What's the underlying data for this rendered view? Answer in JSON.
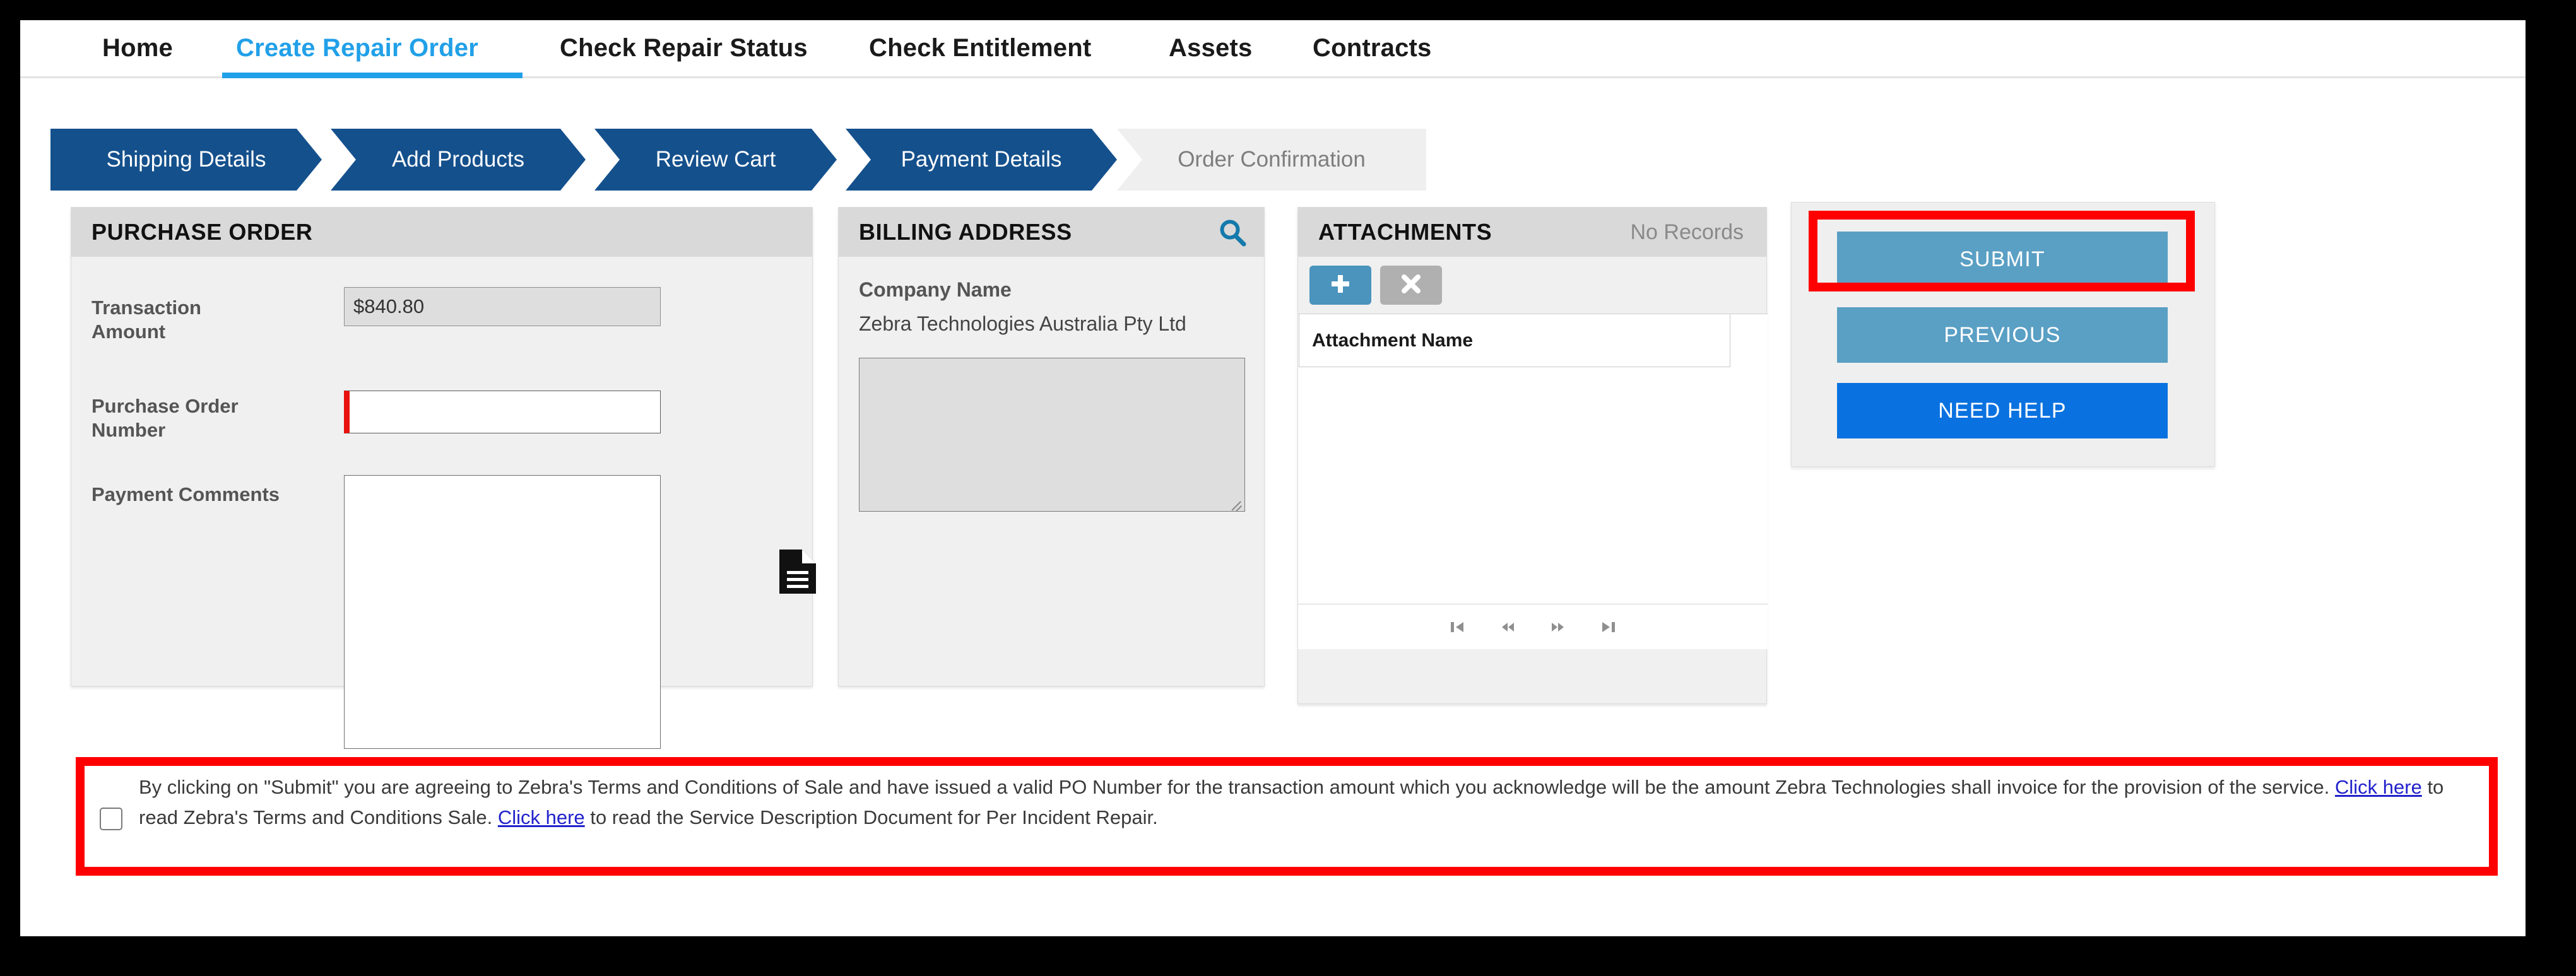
{
  "nav": {
    "items": [
      {
        "label": "Home",
        "active": false
      },
      {
        "label": "Create Repair Order",
        "active": true
      },
      {
        "label": "Check Repair Status",
        "active": false
      },
      {
        "label": "Check Entitlement",
        "active": false
      },
      {
        "label": "Assets",
        "active": false
      },
      {
        "label": "Contracts",
        "active": false
      }
    ]
  },
  "stepper": {
    "steps": [
      {
        "label": "Shipping Details",
        "state": "done"
      },
      {
        "label": "Add Products",
        "state": "done"
      },
      {
        "label": "Review Cart",
        "state": "done"
      },
      {
        "label": "Payment Details",
        "state": "current"
      },
      {
        "label": "Order Confirmation",
        "state": "pending"
      }
    ]
  },
  "purchase_order": {
    "title": "PURCHASE ORDER",
    "transaction_amount_label": "Transaction Amount",
    "transaction_amount_value": "$840.80",
    "po_number_label": "Purchase Order Number",
    "po_number_value": "",
    "po_number_placeholder": "",
    "payment_comments_label": "Payment Comments",
    "payment_comments_value": "",
    "payment_comments_placeholder": "",
    "doc_icon": "document-icon"
  },
  "billing_address": {
    "title": "BILLING ADDRESS",
    "search_icon": "search-icon",
    "company_name_label": "Company Name",
    "company_name_value": "Zebra Technologies Australia Pty Ltd",
    "address_value": ""
  },
  "attachments": {
    "title": "ATTACHMENTS",
    "status": "No Records",
    "add_icon": "plus-icon",
    "delete_icon": "close-icon",
    "columns": [
      "Attachment Name"
    ],
    "rows": [],
    "pager": [
      {
        "name": "first-page",
        "glyph": "⏮"
      },
      {
        "name": "previous-page",
        "glyph": "⏪"
      },
      {
        "name": "next-page",
        "glyph": "⏩"
      },
      {
        "name": "last-page",
        "glyph": "⏭"
      }
    ]
  },
  "actions": {
    "submit_label": "SUBMIT",
    "previous_label": "PREVIOUS",
    "help_label": "NEED HELP"
  },
  "terms": {
    "checked": false,
    "part1": "By clicking on \"Submit\" you are agreeing to Zebra's Terms and Conditions of Sale and have issued a valid PO Number for the transaction amount which you acknowledge will be the amount Zebra Technologies shall invoice for the provision of the service. ",
    "link1": "Click here",
    "part2": " to read Zebra's Terms and Conditions Sale. ",
    "link2": "Click here",
    "part3": " to read the Service Description Document for Per Incident Repair."
  },
  "highlights": {
    "color": "#ff0000",
    "boxes": [
      "submit-button",
      "terms-agreement-bar"
    ]
  },
  "colors": {
    "nav_active": "#21a0e8",
    "step_done": "#14508c",
    "step_pending_bg": "#efefef",
    "button_primary": "#5a9fc4",
    "button_help": "#0a72e0",
    "required_marker": "#e8120e",
    "highlight": "#ff0000"
  }
}
